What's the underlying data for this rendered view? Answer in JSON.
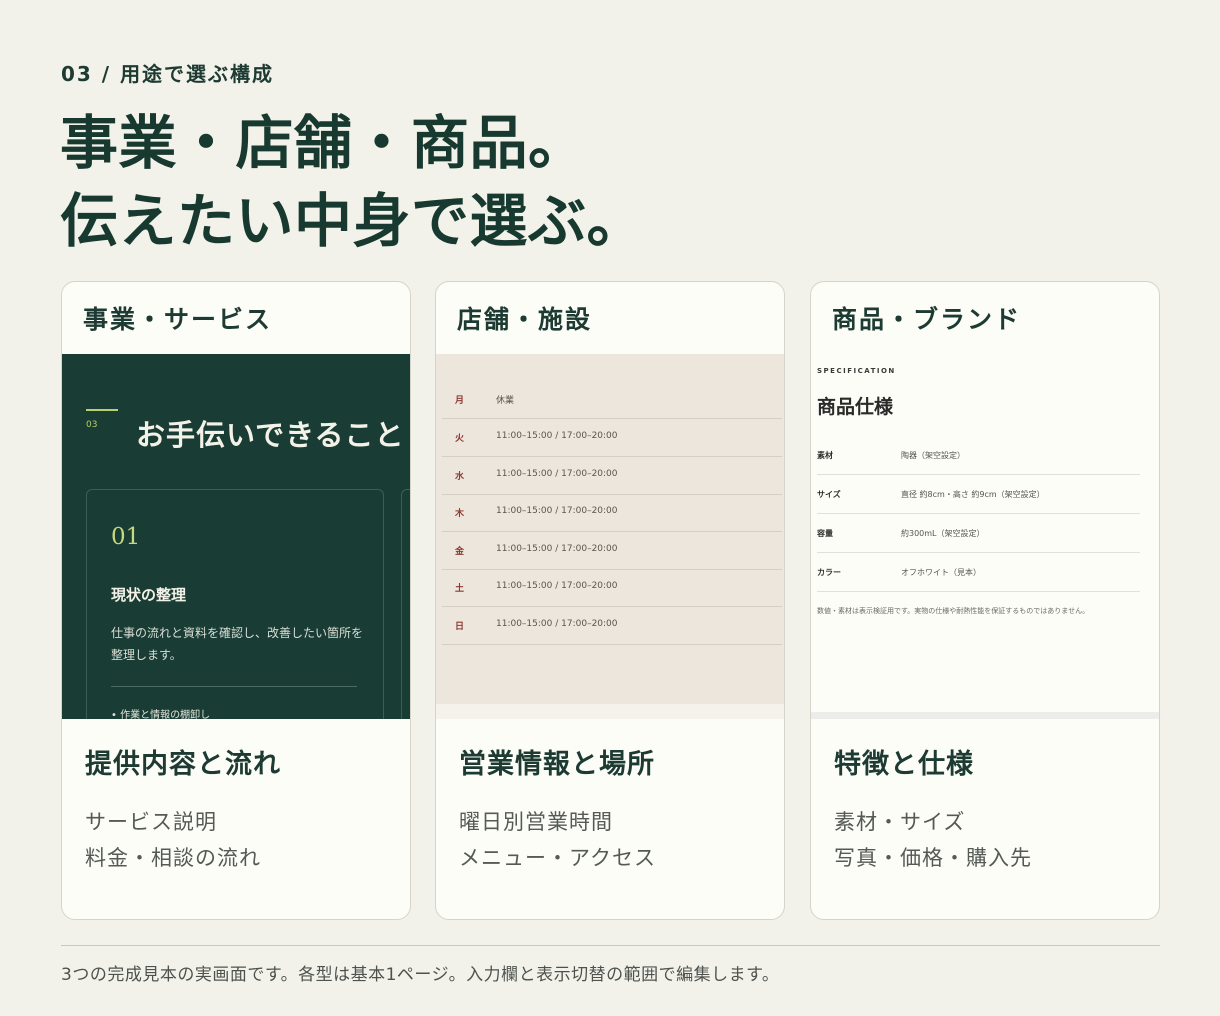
{
  "section": {
    "eyebrow": "03 / 用途で選ぶ構成"
  },
  "headline": {
    "line1": "事業・店舗・商品。",
    "line2": "伝えたい中身で選ぶ。"
  },
  "cards": [
    {
      "label": "事業・サービス",
      "title": "提供内容と流れ",
      "desc": [
        "サービス説明",
        "料金・相談の流れ"
      ],
      "preview": {
        "section_number": "03",
        "section_title": "お手伝いできること",
        "step_number": "01",
        "step_title": "現状の整理",
        "step_text": "仕事の流れと資料を確認し、改善したい箇所を整理します。",
        "bullet": "• 作業と情報の棚卸し",
        "colors": {
          "background": "#193d35",
          "accent": "#b9cf6a"
        }
      }
    },
    {
      "label": "店舗・施設",
      "title": "営業情報と場所",
      "desc": [
        "曜日別営業時間",
        "メニュー・アクセス"
      ],
      "preview": {
        "hours": [
          {
            "day": "月",
            "time": "休業"
          },
          {
            "day": "火",
            "time": "11:00–15:00 / 17:00–20:00"
          },
          {
            "day": "水",
            "time": "11:00–15:00 / 17:00–20:00"
          },
          {
            "day": "木",
            "time": "11:00–15:00 / 17:00–20:00"
          },
          {
            "day": "金",
            "time": "11:00–15:00 / 17:00–20:00"
          },
          {
            "day": "土",
            "time": "11:00–15:00 / 17:00–20:00"
          },
          {
            "day": "日",
            "time": "11:00–15:00 / 17:00–20:00"
          }
        ],
        "colors": {
          "background": "#ede6dc",
          "day": "#8c3a34"
        }
      }
    },
    {
      "label": "商品・ブランド",
      "title": "特徴と仕様",
      "desc": [
        "素材・サイズ",
        "写真・価格・購入先"
      ],
      "preview": {
        "spec_label": "SPECIFICATION",
        "spec_title": "商品仕様",
        "rows": [
          {
            "key": "素材",
            "value": "陶器（架空設定）"
          },
          {
            "key": "サイズ",
            "value": "直径 約8cm・高さ 約9cm（架空設定）"
          },
          {
            "key": "容量",
            "value": "約300mL（架空設定）"
          },
          {
            "key": "カラー",
            "value": "オフホワイト（見本）"
          }
        ],
        "note": "数値・素材は表示検証用です。実物の仕様や耐熱性能を保証するものではありません。"
      }
    }
  ],
  "footnote": "3つの完成見本の実画面です。各型は基本1ページ。入力欄と表示切替の範囲で編集します。",
  "colors": {
    "page_bg": "#f2f2ea",
    "heading": "#17392f",
    "card_bg": "#fdfdf8"
  }
}
